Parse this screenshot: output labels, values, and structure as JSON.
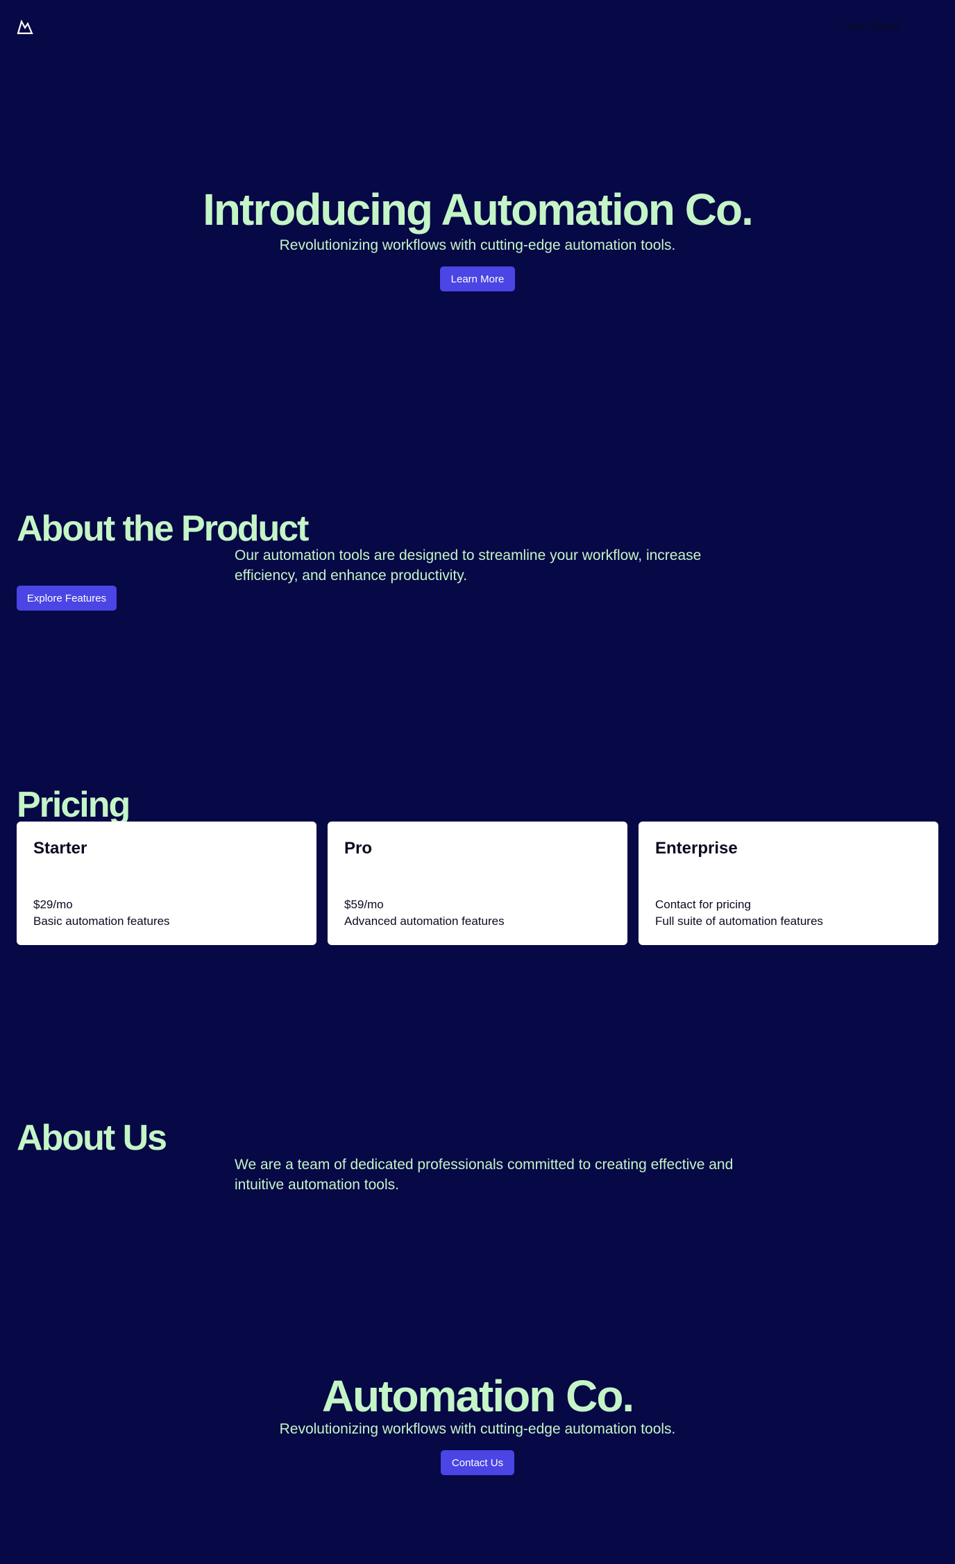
{
  "header": {
    "logo_icon": "mountain-icon",
    "cta_label": "Get Started"
  },
  "hero": {
    "title": "Introducing Automation Co.",
    "subtitle": "Revolutionizing workflows with cutting-edge automation tools.",
    "button_label": "Learn More"
  },
  "about_product": {
    "title": "About the Product",
    "text": "Our automation tools are designed to streamline your workflow, increase efficiency, and enhance productivity.",
    "button_label": "Explore Features"
  },
  "pricing": {
    "title": "Pricing",
    "plans": [
      {
        "name": "Starter",
        "price": "$29/mo",
        "description": "Basic automation features"
      },
      {
        "name": "Pro",
        "price": "$59/mo",
        "description": "Advanced automation features"
      },
      {
        "name": "Enterprise",
        "price": "Contact for pricing",
        "description": "Full suite of automation features"
      }
    ]
  },
  "about_us": {
    "title": "About Us",
    "text": "We are a team of dedicated professionals committed to creating effective and intuitive automation tools."
  },
  "footer": {
    "title": "Automation Co.",
    "subtitle": "Revolutionizing workflows with cutting-edge automation tools.",
    "button_label": "Contact Us"
  },
  "colors": {
    "background": "#070846",
    "accent_text": "#c4f5c6",
    "button": "#4a45e4",
    "card": "#ffffff"
  }
}
